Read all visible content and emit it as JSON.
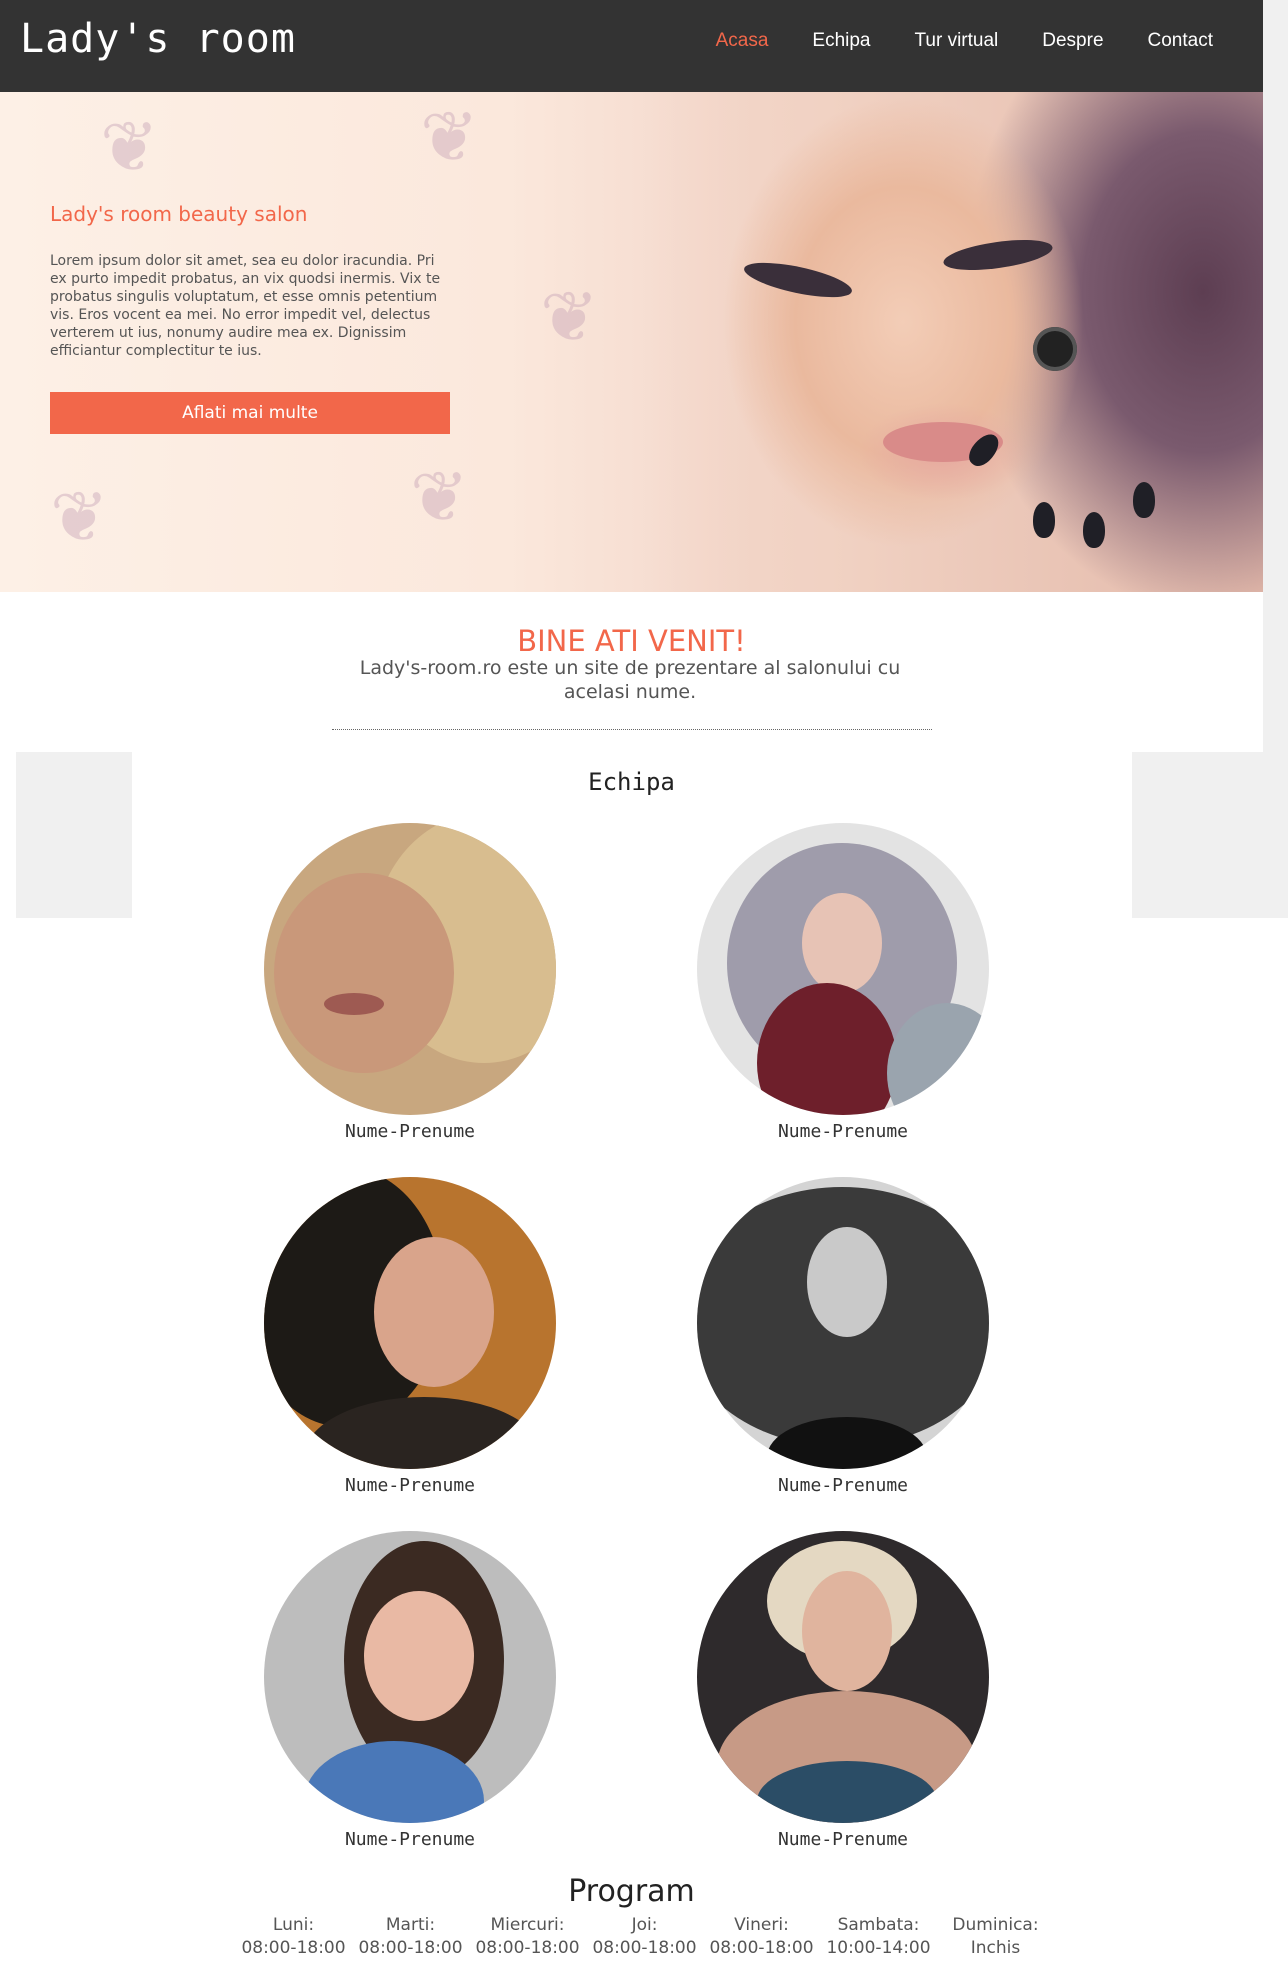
{
  "header": {
    "logo": "Lady's room",
    "nav": [
      "Acasa",
      "Echipa",
      "Tur virtual",
      "Despre",
      "Contact"
    ],
    "active": "Acasa"
  },
  "hero": {
    "title": "Lady's room beauty salon",
    "text": "Lorem ipsum dolor sit amet, sea eu dolor iracundia. Pri ex purto impedit probatus, an vix quodsi inermis. Vix te probatus singulis voluptatum, et esse omnis petentium vis. Eros vocent ea mei. No error impedit vel, delectus verterem ut ius, nonumy audire mea ex. Dignissim efficiantur complectitur te ius.",
    "button": "Aflati mai multe"
  },
  "welcome": {
    "title": "BINE ATI VENIT!",
    "text": "Lady's-room.ro este un site de prezentare al salonului cu acelasi nume."
  },
  "team": {
    "title": "Echipa",
    "members": [
      {
        "name": "Nume-Prenume"
      },
      {
        "name": "Nume-Prenume"
      },
      {
        "name": "Nume-Prenume"
      },
      {
        "name": "Nume-Prenume"
      },
      {
        "name": "Nume-Prenume"
      },
      {
        "name": "Nume-Prenume"
      }
    ]
  },
  "program": {
    "title": "Program",
    "days": [
      {
        "day": "Luni:",
        "hours": "08:00-18:00"
      },
      {
        "day": "Marti:",
        "hours": "08:00-18:00"
      },
      {
        "day": "Miercuri:",
        "hours": "08:00-18:00"
      },
      {
        "day": "Joi:",
        "hours": "08:00-18:00"
      },
      {
        "day": "Vineri:",
        "hours": "08:00-18:00"
      },
      {
        "day": "Sambata:",
        "hours": "10:00-14:00"
      },
      {
        "day": "Duminica:",
        "hours": "Inchis"
      }
    ]
  },
  "colors": {
    "accent": "#f2674a",
    "header_bg": "#333333",
    "panel_bg": "#f0f0f0"
  }
}
